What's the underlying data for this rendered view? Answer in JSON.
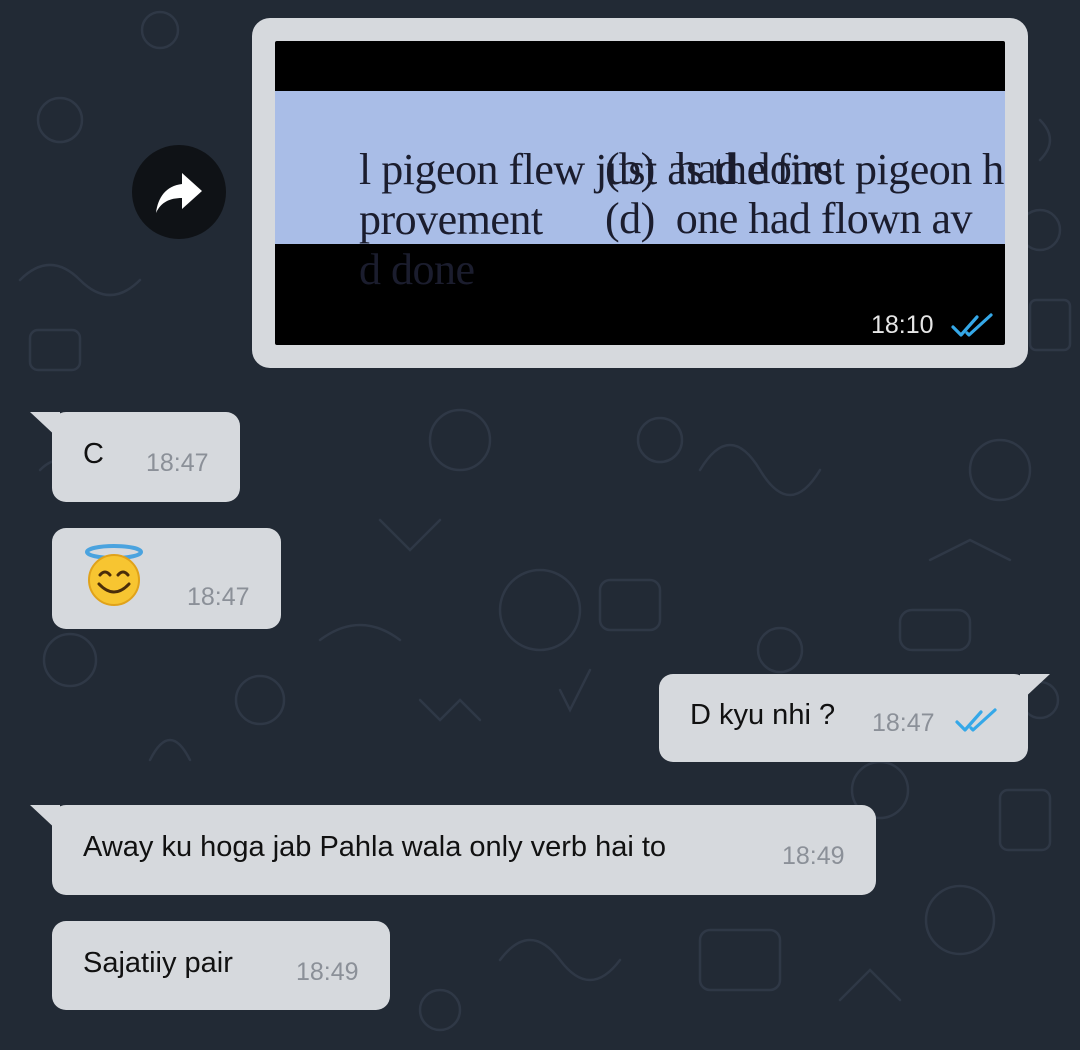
{
  "image_message": {
    "lines": [
      {
        "left": "l pigeon flew just as the first pigeon had",
        "right": ""
      },
      {
        "left": "provement",
        "right": "(b)  had done"
      },
      {
        "left": "d done",
        "right": "(d)  one had flown av"
      }
    ],
    "time": "18:10",
    "status_icon": "double-check-icon"
  },
  "forward_button": {
    "icon": "forward-arrow-icon"
  },
  "messages": [
    {
      "text": "C",
      "time": "18:47",
      "direction": "incoming"
    },
    {
      "emoji": "smiling-face-with-halo-emoji",
      "time": "18:47",
      "direction": "incoming"
    },
    {
      "text": "D kyu nhi ?",
      "time": "18:47",
      "direction": "outgoing",
      "status_icon": "double-check-icon"
    },
    {
      "text": "Away ku hoga jab Pahla wala only verb hai to",
      "time": "18:49",
      "direction": "incoming"
    },
    {
      "text": "Sajatiiy pair",
      "time": "18:49",
      "direction": "incoming"
    }
  ],
  "colors": {
    "background": "#222a35",
    "bubble": "#d6d9dd",
    "tick_read": "#35a8e8",
    "timestamp": "#8b9098"
  }
}
